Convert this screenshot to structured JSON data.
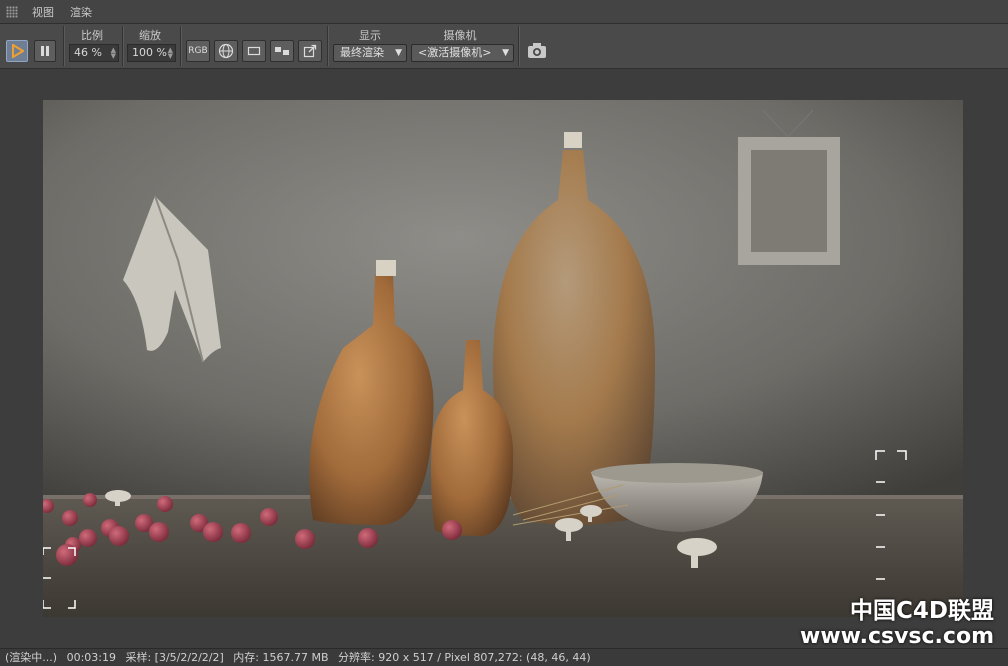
{
  "menu": {
    "items": [
      "视图",
      "渲染"
    ]
  },
  "toolbar": {
    "ratio_label": "比例",
    "ratio_value": "46 %",
    "zoom_label": "缩放",
    "zoom_value": "100 %",
    "rgb_label": "RGB",
    "display_label": "显示",
    "display_value": "最终渲染",
    "camera_label": "摄像机",
    "camera_value": "<激活摄像机>"
  },
  "status": {
    "state": "(渲染中...)",
    "time": "00:03:19",
    "samples": "采样: [3/5/2/2/2/2]",
    "memory": "内存: 1567.77 MB",
    "resolution": "分辨率: 920 x 517 / Pixel 807,272: (48, 46, 44)"
  },
  "watermark": {
    "line1": "中国C4D联盟",
    "line2": "www.csvsc.com"
  },
  "colors": {
    "accent": "#8fa6c4",
    "play": "#f0a030"
  }
}
